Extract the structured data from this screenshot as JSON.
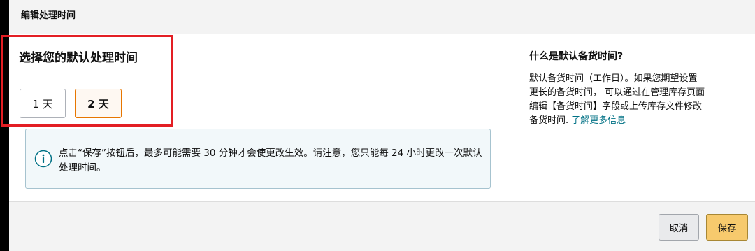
{
  "header": {
    "title": "编辑处理时间"
  },
  "main": {
    "section_title": "选择您的默认处理时间",
    "options": [
      {
        "label": "1 天",
        "selected": false
      },
      {
        "label": "2 天",
        "selected": true
      }
    ],
    "info": {
      "icon": "info-icon",
      "text": "点击“保存”按钮后，最多可能需要 30 分钟才会使更改生效。请注意，您只能每 24 小时更改一次默认处理时间。"
    }
  },
  "side": {
    "title": "什么是默认备货时间?",
    "lines": [
      "默认备货时间（工作日）。如果您期望设置",
      "更长的备货时间， 可以通过在管理库存页面",
      "编辑【备货时间】字段或上传库存文件修改"
    ],
    "last_line_prefix": "备货时间. ",
    "link": "了解更多信息"
  },
  "footer": {
    "cancel_label": "取消",
    "save_label": "保存"
  },
  "colors": {
    "highlight_border": "#e31e24",
    "selected_option_border": "#e77600",
    "info_icon": "#007185",
    "link": "#007185",
    "save_button": "#f7ca6d"
  }
}
